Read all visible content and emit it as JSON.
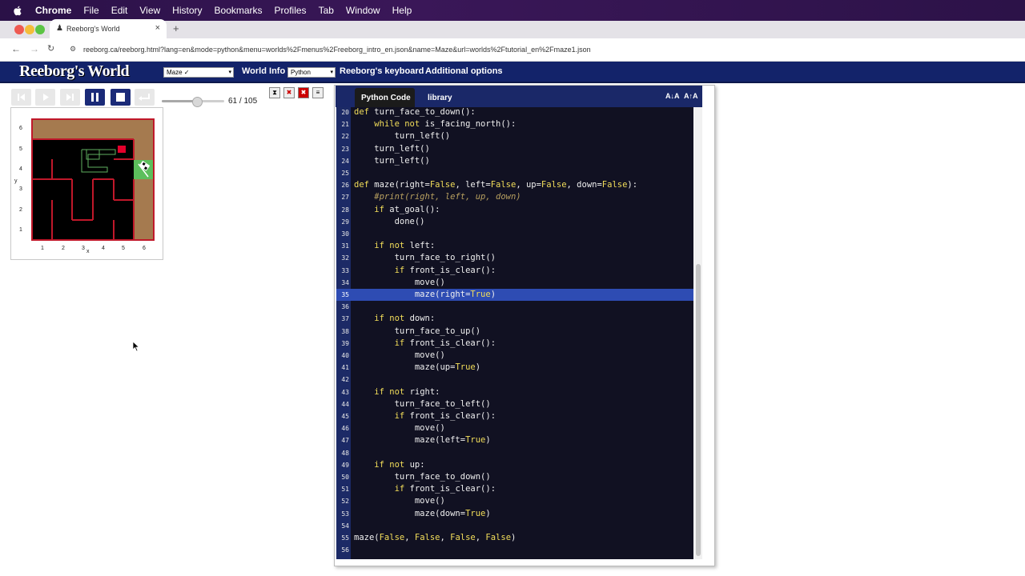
{
  "menubar": {
    "items": [
      "Chrome",
      "File",
      "Edit",
      "View",
      "History",
      "Bookmarks",
      "Profiles",
      "Tab",
      "Window",
      "Help"
    ]
  },
  "browser": {
    "tab_title": "Reeborg's World",
    "new_tab": "+",
    "url": "reeborg.ca/reeborg.html?lang=en&mode=python&menu=worlds%2Fmenus%2Freeborg_intro_en.json&name=Maze&url=worlds%2Ftutorial_en%2Fmaze1.json"
  },
  "header": {
    "logo": "Reeborg's World",
    "world_select": "Maze ✓",
    "world_info": "World Info",
    "language_select": "Python",
    "keyboard": "Reeborg's keyboard",
    "options": "Additional options"
  },
  "controls": {
    "steps": "61 / 105"
  },
  "world": {
    "y_labels": [
      "6",
      "5",
      "4",
      "3",
      "2",
      "1"
    ],
    "x_labels": [
      "1",
      "2",
      "3",
      "4",
      "5",
      "6"
    ],
    "y_axis": "y",
    "x_axis": "x",
    "colors": {
      "wall": "#c0182a",
      "path": "#5fb05f",
      "ground": "#a57a4f",
      "goal": "#5cbf5c"
    }
  },
  "editor": {
    "tabs": [
      "Python Code",
      "library"
    ],
    "font_buttons": [
      "A↓A",
      "A↑A"
    ],
    "highlight_line": 35,
    "lines": [
      {
        "n": "20",
        "t": "def turn_face_to_down():"
      },
      {
        "n": "21",
        "t": "    while not is_facing_north():"
      },
      {
        "n": "22",
        "t": "        turn_left()"
      },
      {
        "n": "23",
        "t": "    turn_left()"
      },
      {
        "n": "24",
        "t": "    turn_left()"
      },
      {
        "n": "25",
        "t": ""
      },
      {
        "n": "26",
        "t": "def maze(right=False, left=False, up=False, down=False):"
      },
      {
        "n": "27",
        "t": "    #print(right, left, up, down)"
      },
      {
        "n": "28",
        "t": "    if at_goal():"
      },
      {
        "n": "29",
        "t": "        done()"
      },
      {
        "n": "30",
        "t": ""
      },
      {
        "n": "31",
        "t": "    if not left:"
      },
      {
        "n": "32",
        "t": "        turn_face_to_right()"
      },
      {
        "n": "33",
        "t": "        if front_is_clear():"
      },
      {
        "n": "34",
        "t": "            move()"
      },
      {
        "n": "35",
        "t": "            maze(right=True)"
      },
      {
        "n": "36",
        "t": ""
      },
      {
        "n": "37",
        "t": "    if not down:"
      },
      {
        "n": "38",
        "t": "        turn_face_to_up()"
      },
      {
        "n": "39",
        "t": "        if front_is_clear():"
      },
      {
        "n": "40",
        "t": "            move()"
      },
      {
        "n": "41",
        "t": "            maze(up=True)"
      },
      {
        "n": "42",
        "t": ""
      },
      {
        "n": "43",
        "t": "    if not right:"
      },
      {
        "n": "44",
        "t": "        turn_face_to_left()"
      },
      {
        "n": "45",
        "t": "        if front_is_clear():"
      },
      {
        "n": "46",
        "t": "            move()"
      },
      {
        "n": "47",
        "t": "            maze(left=True)"
      },
      {
        "n": "48",
        "t": ""
      },
      {
        "n": "49",
        "t": "    if not up:"
      },
      {
        "n": "50",
        "t": "        turn_face_to_down()"
      },
      {
        "n": "51",
        "t": "        if front_is_clear():"
      },
      {
        "n": "52",
        "t": "            move()"
      },
      {
        "n": "53",
        "t": "            maze(down=True)"
      },
      {
        "n": "54",
        "t": ""
      },
      {
        "n": "55",
        "t": "maze(False, False, False, False)"
      },
      {
        "n": "56",
        "t": ""
      }
    ]
  }
}
